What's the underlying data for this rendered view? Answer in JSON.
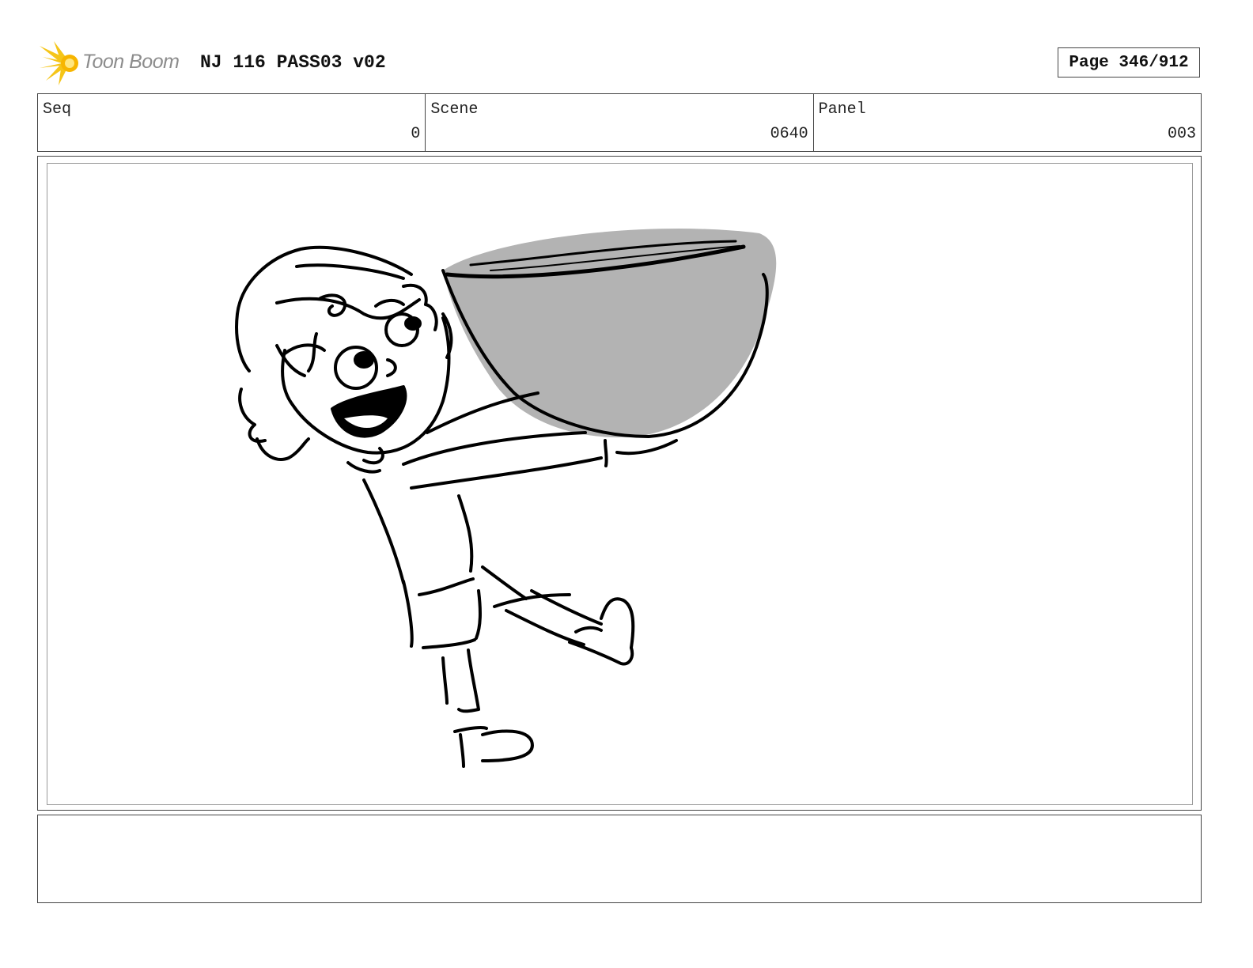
{
  "header": {
    "logo_text": "Toon Boom",
    "project_title": "NJ 116 PASS03 v02",
    "page_label": "Page 346/912"
  },
  "info": {
    "seq_label": "Seq",
    "seq_value": "0",
    "scene_label": "Scene",
    "scene_value": "0640",
    "panel_label": "Panel",
    "panel_value": "003"
  },
  "notes": {
    "text": ""
  },
  "colors": {
    "logo_burst": "#f5c518",
    "bowl_fill": "#b3b3b3",
    "line": "#000000"
  }
}
